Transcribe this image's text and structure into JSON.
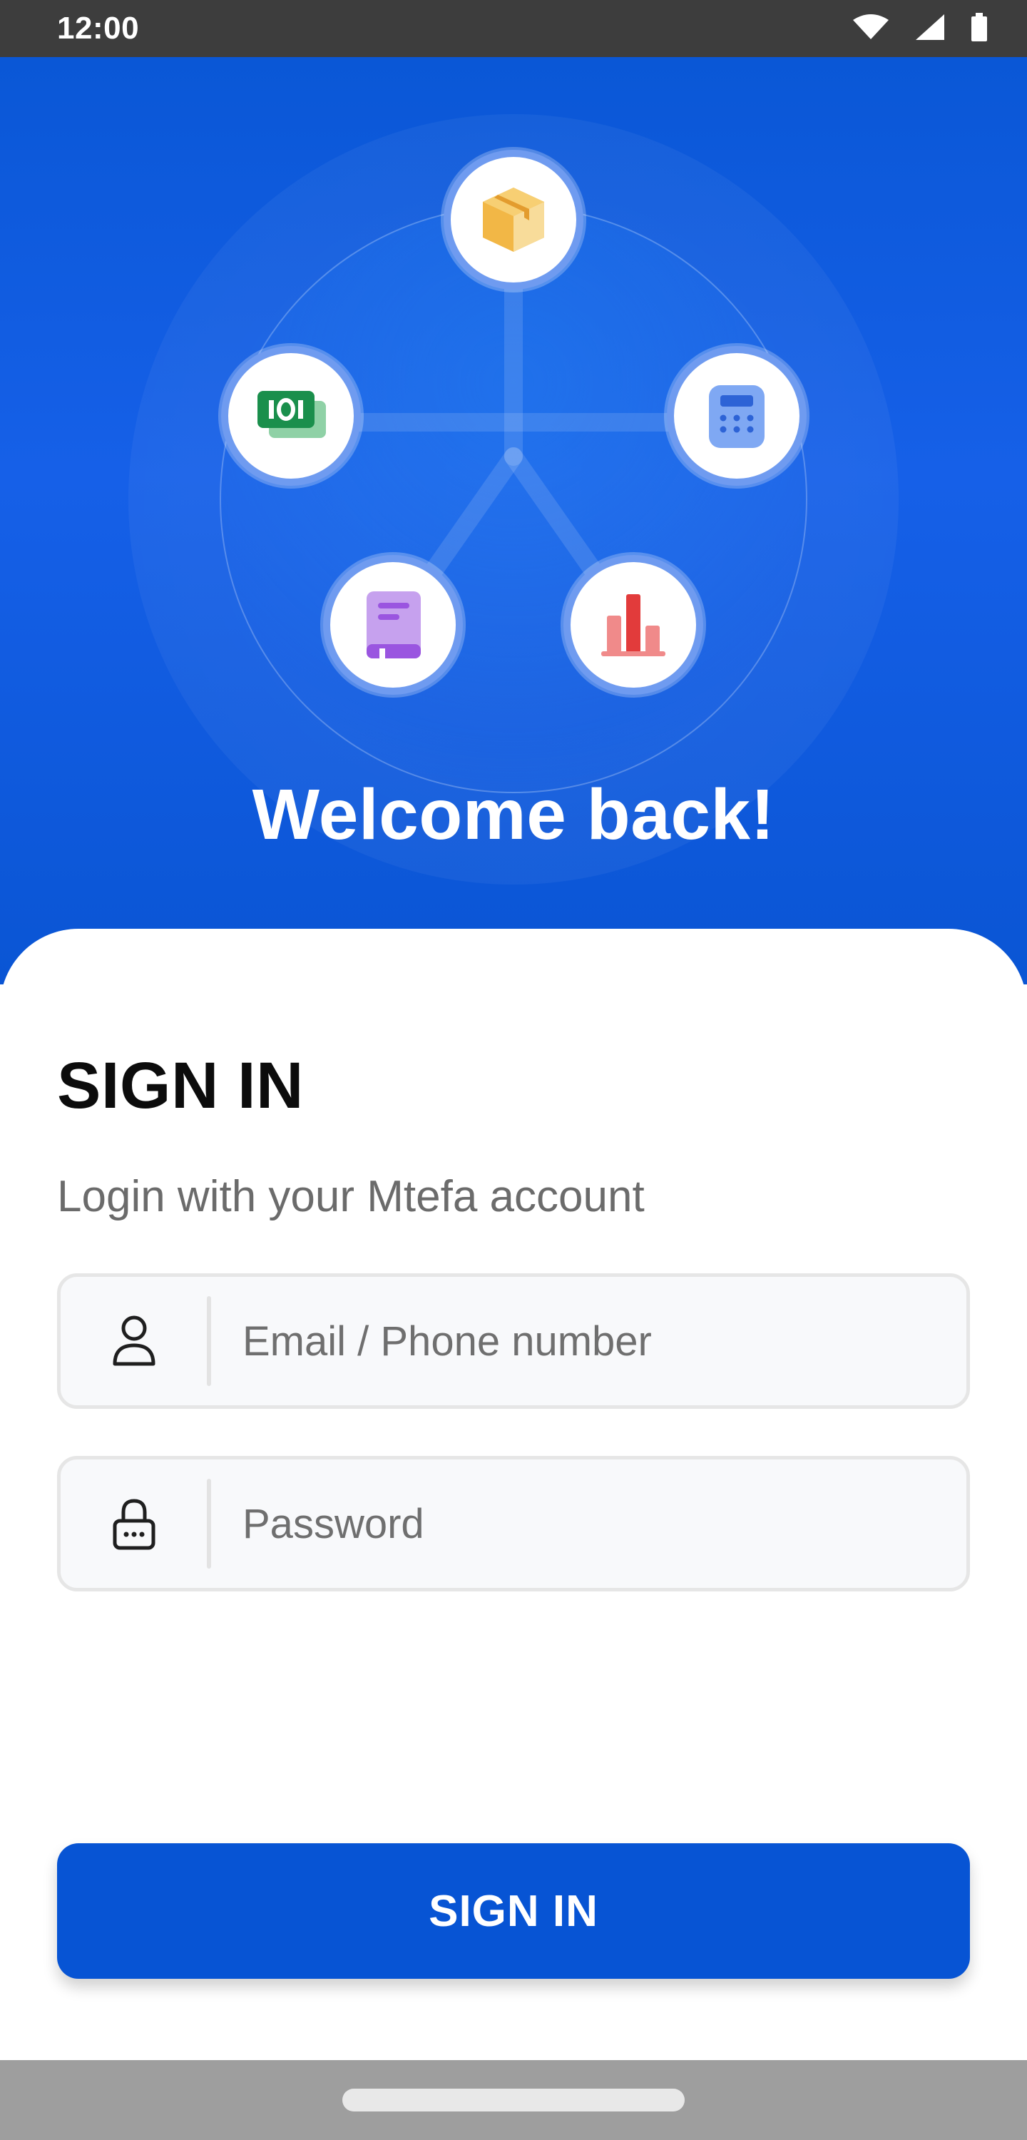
{
  "status_bar": {
    "time": "12:00",
    "icons": [
      "wifi-icon",
      "signal-icon",
      "battery-icon"
    ]
  },
  "hero": {
    "welcome_text": "Welcome back!",
    "feature_icons": [
      "box-icon",
      "cash-icon",
      "calculator-icon",
      "book-icon",
      "bar-chart-icon"
    ],
    "colors": {
      "background": "#0a57d6",
      "node_ring": "#6f9bf0"
    }
  },
  "login": {
    "title": "SIGN IN",
    "subtitle": "Login with your Mtefa account",
    "email": {
      "placeholder": "Email / Phone number",
      "value": "",
      "icon": "user-icon"
    },
    "password": {
      "placeholder": "Password",
      "value": "",
      "icon": "lock-icon"
    },
    "button_label": "SIGN IN"
  },
  "colors": {
    "primary": "#0754d4",
    "field_background": "#f8f9fb",
    "field_border": "#e6e6e6"
  }
}
